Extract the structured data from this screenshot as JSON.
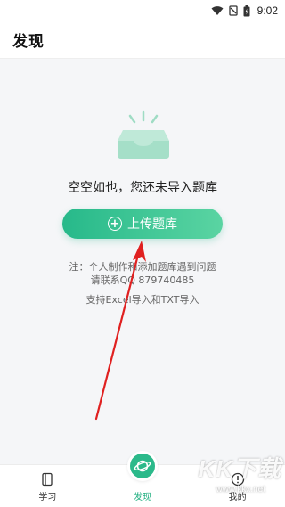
{
  "status_bar": {
    "time": "9:02"
  },
  "header": {
    "title": "发现"
  },
  "empty_state": {
    "message": "空空如也，您还未导入题库",
    "upload_label": "上传题库",
    "note_line1": "注：个人制作和添加题库遇到问题",
    "note_line2": "请联系QQ 879740485",
    "note_line3": "支持Excel导入和TXT导入"
  },
  "nav": {
    "items": [
      {
        "label": "学习",
        "icon": "book-icon"
      },
      {
        "label": "发现",
        "icon": "planet-icon",
        "active": true
      },
      {
        "label": "我的",
        "icon": "info-icon"
      }
    ]
  },
  "watermark": {
    "text": "KK下载",
    "url": "www.kkx.net"
  },
  "colors": {
    "accent": "#27b98a",
    "arrow": "#e02020"
  }
}
